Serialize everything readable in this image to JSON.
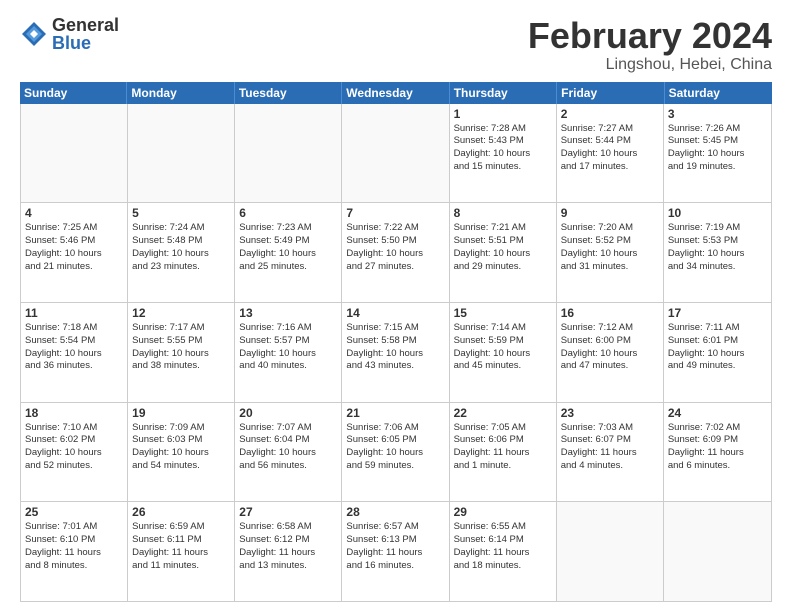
{
  "logo": {
    "general": "General",
    "blue": "Blue"
  },
  "title": "February 2024",
  "subtitle": "Lingshou, Hebei, China",
  "header_days": [
    "Sunday",
    "Monday",
    "Tuesday",
    "Wednesday",
    "Thursday",
    "Friday",
    "Saturday"
  ],
  "weeks": [
    [
      {
        "day": "",
        "info": "",
        "empty": true
      },
      {
        "day": "",
        "info": "",
        "empty": true
      },
      {
        "day": "",
        "info": "",
        "empty": true
      },
      {
        "day": "",
        "info": "",
        "empty": true
      },
      {
        "day": "1",
        "info": "Sunrise: 7:28 AM\nSunset: 5:43 PM\nDaylight: 10 hours\nand 15 minutes.",
        "empty": false
      },
      {
        "day": "2",
        "info": "Sunrise: 7:27 AM\nSunset: 5:44 PM\nDaylight: 10 hours\nand 17 minutes.",
        "empty": false
      },
      {
        "day": "3",
        "info": "Sunrise: 7:26 AM\nSunset: 5:45 PM\nDaylight: 10 hours\nand 19 minutes.",
        "empty": false
      }
    ],
    [
      {
        "day": "4",
        "info": "Sunrise: 7:25 AM\nSunset: 5:46 PM\nDaylight: 10 hours\nand 21 minutes.",
        "empty": false
      },
      {
        "day": "5",
        "info": "Sunrise: 7:24 AM\nSunset: 5:48 PM\nDaylight: 10 hours\nand 23 minutes.",
        "empty": false
      },
      {
        "day": "6",
        "info": "Sunrise: 7:23 AM\nSunset: 5:49 PM\nDaylight: 10 hours\nand 25 minutes.",
        "empty": false
      },
      {
        "day": "7",
        "info": "Sunrise: 7:22 AM\nSunset: 5:50 PM\nDaylight: 10 hours\nand 27 minutes.",
        "empty": false
      },
      {
        "day": "8",
        "info": "Sunrise: 7:21 AM\nSunset: 5:51 PM\nDaylight: 10 hours\nand 29 minutes.",
        "empty": false
      },
      {
        "day": "9",
        "info": "Sunrise: 7:20 AM\nSunset: 5:52 PM\nDaylight: 10 hours\nand 31 minutes.",
        "empty": false
      },
      {
        "day": "10",
        "info": "Sunrise: 7:19 AM\nSunset: 5:53 PM\nDaylight: 10 hours\nand 34 minutes.",
        "empty": false
      }
    ],
    [
      {
        "day": "11",
        "info": "Sunrise: 7:18 AM\nSunset: 5:54 PM\nDaylight: 10 hours\nand 36 minutes.",
        "empty": false
      },
      {
        "day": "12",
        "info": "Sunrise: 7:17 AM\nSunset: 5:55 PM\nDaylight: 10 hours\nand 38 minutes.",
        "empty": false
      },
      {
        "day": "13",
        "info": "Sunrise: 7:16 AM\nSunset: 5:57 PM\nDaylight: 10 hours\nand 40 minutes.",
        "empty": false
      },
      {
        "day": "14",
        "info": "Sunrise: 7:15 AM\nSunset: 5:58 PM\nDaylight: 10 hours\nand 43 minutes.",
        "empty": false
      },
      {
        "day": "15",
        "info": "Sunrise: 7:14 AM\nSunset: 5:59 PM\nDaylight: 10 hours\nand 45 minutes.",
        "empty": false
      },
      {
        "day": "16",
        "info": "Sunrise: 7:12 AM\nSunset: 6:00 PM\nDaylight: 10 hours\nand 47 minutes.",
        "empty": false
      },
      {
        "day": "17",
        "info": "Sunrise: 7:11 AM\nSunset: 6:01 PM\nDaylight: 10 hours\nand 49 minutes.",
        "empty": false
      }
    ],
    [
      {
        "day": "18",
        "info": "Sunrise: 7:10 AM\nSunset: 6:02 PM\nDaylight: 10 hours\nand 52 minutes.",
        "empty": false
      },
      {
        "day": "19",
        "info": "Sunrise: 7:09 AM\nSunset: 6:03 PM\nDaylight: 10 hours\nand 54 minutes.",
        "empty": false
      },
      {
        "day": "20",
        "info": "Sunrise: 7:07 AM\nSunset: 6:04 PM\nDaylight: 10 hours\nand 56 minutes.",
        "empty": false
      },
      {
        "day": "21",
        "info": "Sunrise: 7:06 AM\nSunset: 6:05 PM\nDaylight: 10 hours\nand 59 minutes.",
        "empty": false
      },
      {
        "day": "22",
        "info": "Sunrise: 7:05 AM\nSunset: 6:06 PM\nDaylight: 11 hours\nand 1 minute.",
        "empty": false
      },
      {
        "day": "23",
        "info": "Sunrise: 7:03 AM\nSunset: 6:07 PM\nDaylight: 11 hours\nand 4 minutes.",
        "empty": false
      },
      {
        "day": "24",
        "info": "Sunrise: 7:02 AM\nSunset: 6:09 PM\nDaylight: 11 hours\nand 6 minutes.",
        "empty": false
      }
    ],
    [
      {
        "day": "25",
        "info": "Sunrise: 7:01 AM\nSunset: 6:10 PM\nDaylight: 11 hours\nand 8 minutes.",
        "empty": false
      },
      {
        "day": "26",
        "info": "Sunrise: 6:59 AM\nSunset: 6:11 PM\nDaylight: 11 hours\nand 11 minutes.",
        "empty": false
      },
      {
        "day": "27",
        "info": "Sunrise: 6:58 AM\nSunset: 6:12 PM\nDaylight: 11 hours\nand 13 minutes.",
        "empty": false
      },
      {
        "day": "28",
        "info": "Sunrise: 6:57 AM\nSunset: 6:13 PM\nDaylight: 11 hours\nand 16 minutes.",
        "empty": false
      },
      {
        "day": "29",
        "info": "Sunrise: 6:55 AM\nSunset: 6:14 PM\nDaylight: 11 hours\nand 18 minutes.",
        "empty": false
      },
      {
        "day": "",
        "info": "",
        "empty": true
      },
      {
        "day": "",
        "info": "",
        "empty": true
      }
    ]
  ]
}
